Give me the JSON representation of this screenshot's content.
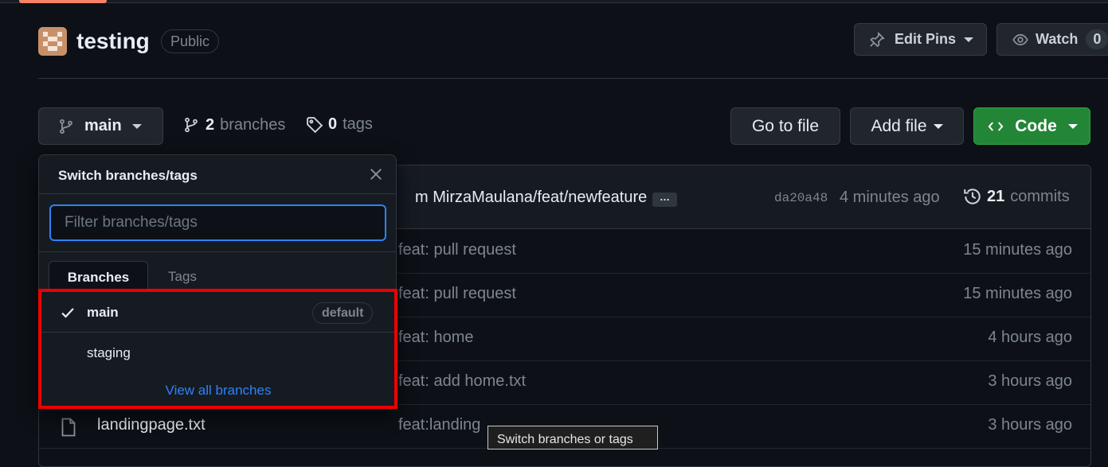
{
  "repo": {
    "name": "testing",
    "visibility": "Public",
    "edit_pins_label": "Edit Pins",
    "watch_label": "Watch",
    "watch_count": "0"
  },
  "branch_bar": {
    "current_branch": "main",
    "branch_count": "2",
    "branches_label": "branches",
    "tag_count": "0",
    "tags_label": "tags",
    "go_to_file": "Go to file",
    "add_file": "Add file",
    "code": "Code"
  },
  "latest_commit": {
    "message": "m MirzaMaulana/feat/newfeature",
    "more": "…",
    "sha": "da20a48",
    "age": "4 minutes ago",
    "commits_count": "21",
    "commits_label": "commits"
  },
  "files": [
    {
      "name": "",
      "message": "feat: pull request",
      "age": "15 minutes ago"
    },
    {
      "name": "",
      "message": "feat: pull request",
      "age": "15 minutes ago"
    },
    {
      "name": "",
      "message": "feat: home",
      "age": "4 hours ago"
    },
    {
      "name": "",
      "message": "feat: add home.txt",
      "age": "3 hours ago"
    },
    {
      "name": "landingpage.txt",
      "message": "feat:landing",
      "age": "3 hours ago"
    }
  ],
  "dropdown": {
    "title": "Switch branches/tags",
    "filter_placeholder": "Filter branches/tags",
    "tab_branches": "Branches",
    "tab_tags": "Tags",
    "branches": [
      {
        "name": "main",
        "badge": "default"
      },
      {
        "name": "staging"
      }
    ],
    "view_all": "View all branches"
  },
  "tooltip": "Switch branches or tags",
  "colors": {
    "background": "#0d1117",
    "accent_blue": "#2f81f7",
    "code_green": "#238636",
    "highlight_red": "#ee0000"
  }
}
